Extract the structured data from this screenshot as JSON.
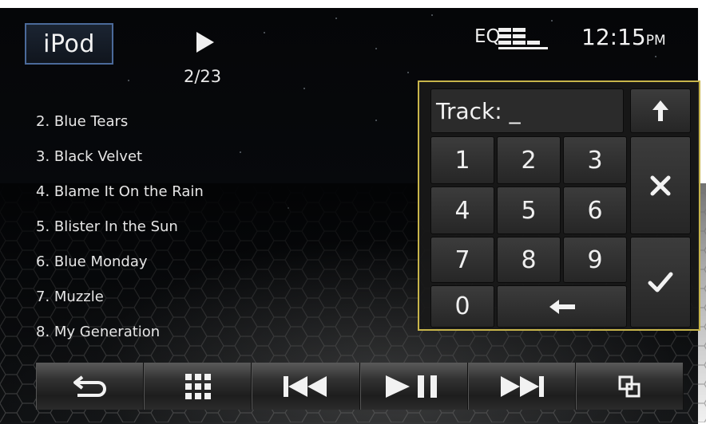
{
  "header": {
    "source_label": "iPod",
    "track_position": "2/23",
    "eq_label": "EQ",
    "clock_time": "12:15",
    "clock_ampm": "PM"
  },
  "tracks": [
    "2. Blue Tears",
    "3. Black Velvet",
    "4. Blame It On the Rain",
    "5. Blister In the Sun",
    "6. Blue Monday",
    "7. Muzzle",
    "8. My Generation"
  ],
  "keypad": {
    "track_field_text": "Track: _",
    "digits": [
      "1",
      "2",
      "3",
      "4",
      "5",
      "6",
      "7",
      "8",
      "9",
      "0"
    ]
  },
  "icons": {
    "up": "arrow-up-icon",
    "clear": "close-icon",
    "confirm": "checkmark-icon",
    "backspace": "arrow-left-icon"
  },
  "colors": {
    "keypad_border": "#c8b54b",
    "source_border": "#4b6a9a"
  }
}
